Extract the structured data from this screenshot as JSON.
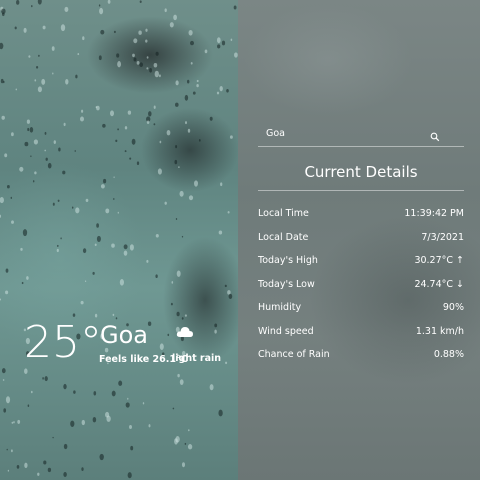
{
  "current": {
    "temperature": "25°",
    "city": "Goa",
    "feels_like": "Feels like 26.1°C",
    "condition": "light rain",
    "condition_icon": "cloud-icon"
  },
  "search": {
    "value": "Goa",
    "icon": "search-icon"
  },
  "details": {
    "title": "Current Details",
    "rows": [
      {
        "label": "Local Time",
        "value": "11:39:42 PM"
      },
      {
        "label": "Local Date",
        "value": "7/3/2021"
      },
      {
        "label": "Today's High",
        "value": "30.27°C ↑"
      },
      {
        "label": "Today's Low",
        "value": "24.74°C ↓"
      },
      {
        "label": "Humidity",
        "value": "90%"
      },
      {
        "label": "Wind speed",
        "value": "1.31 km/h"
      },
      {
        "label": "Chance of Rain",
        "value": "0.88%"
      }
    ]
  },
  "colors": {
    "text": "#ffffff",
    "left_panel": "#628782",
    "right_panel": "#747f7e"
  }
}
